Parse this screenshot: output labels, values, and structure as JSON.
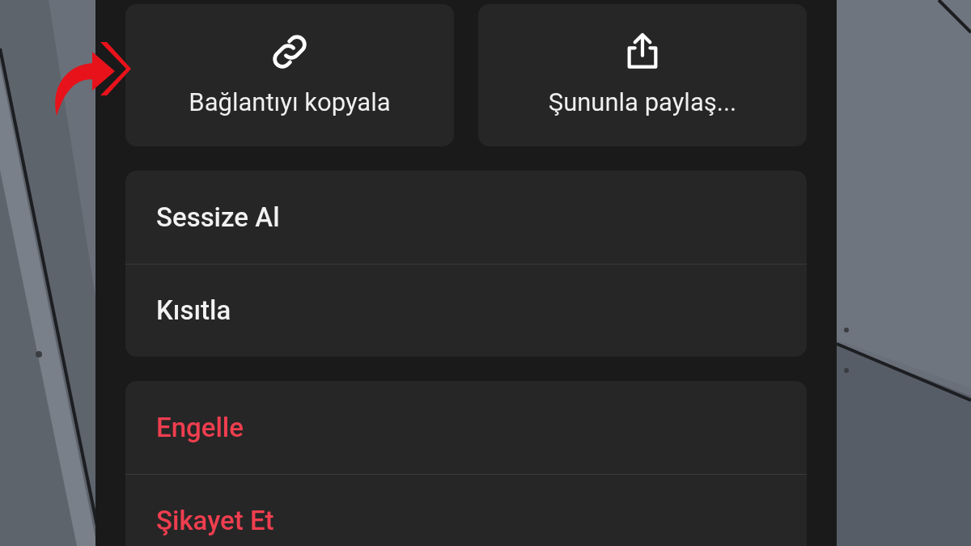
{
  "quick_actions": [
    {
      "kind": "link",
      "label": "Bağlantıyı kopyala"
    },
    {
      "kind": "share",
      "label": "Şununla paylaş..."
    }
  ],
  "groups": [
    {
      "items": [
        {
          "label": "Sessize Al",
          "destructive": false
        },
        {
          "label": "Kısıtla",
          "destructive": false
        }
      ]
    },
    {
      "items": [
        {
          "label": "Engelle",
          "destructive": true
        },
        {
          "label": "Şikayet Et",
          "destructive": true
        }
      ]
    }
  ]
}
